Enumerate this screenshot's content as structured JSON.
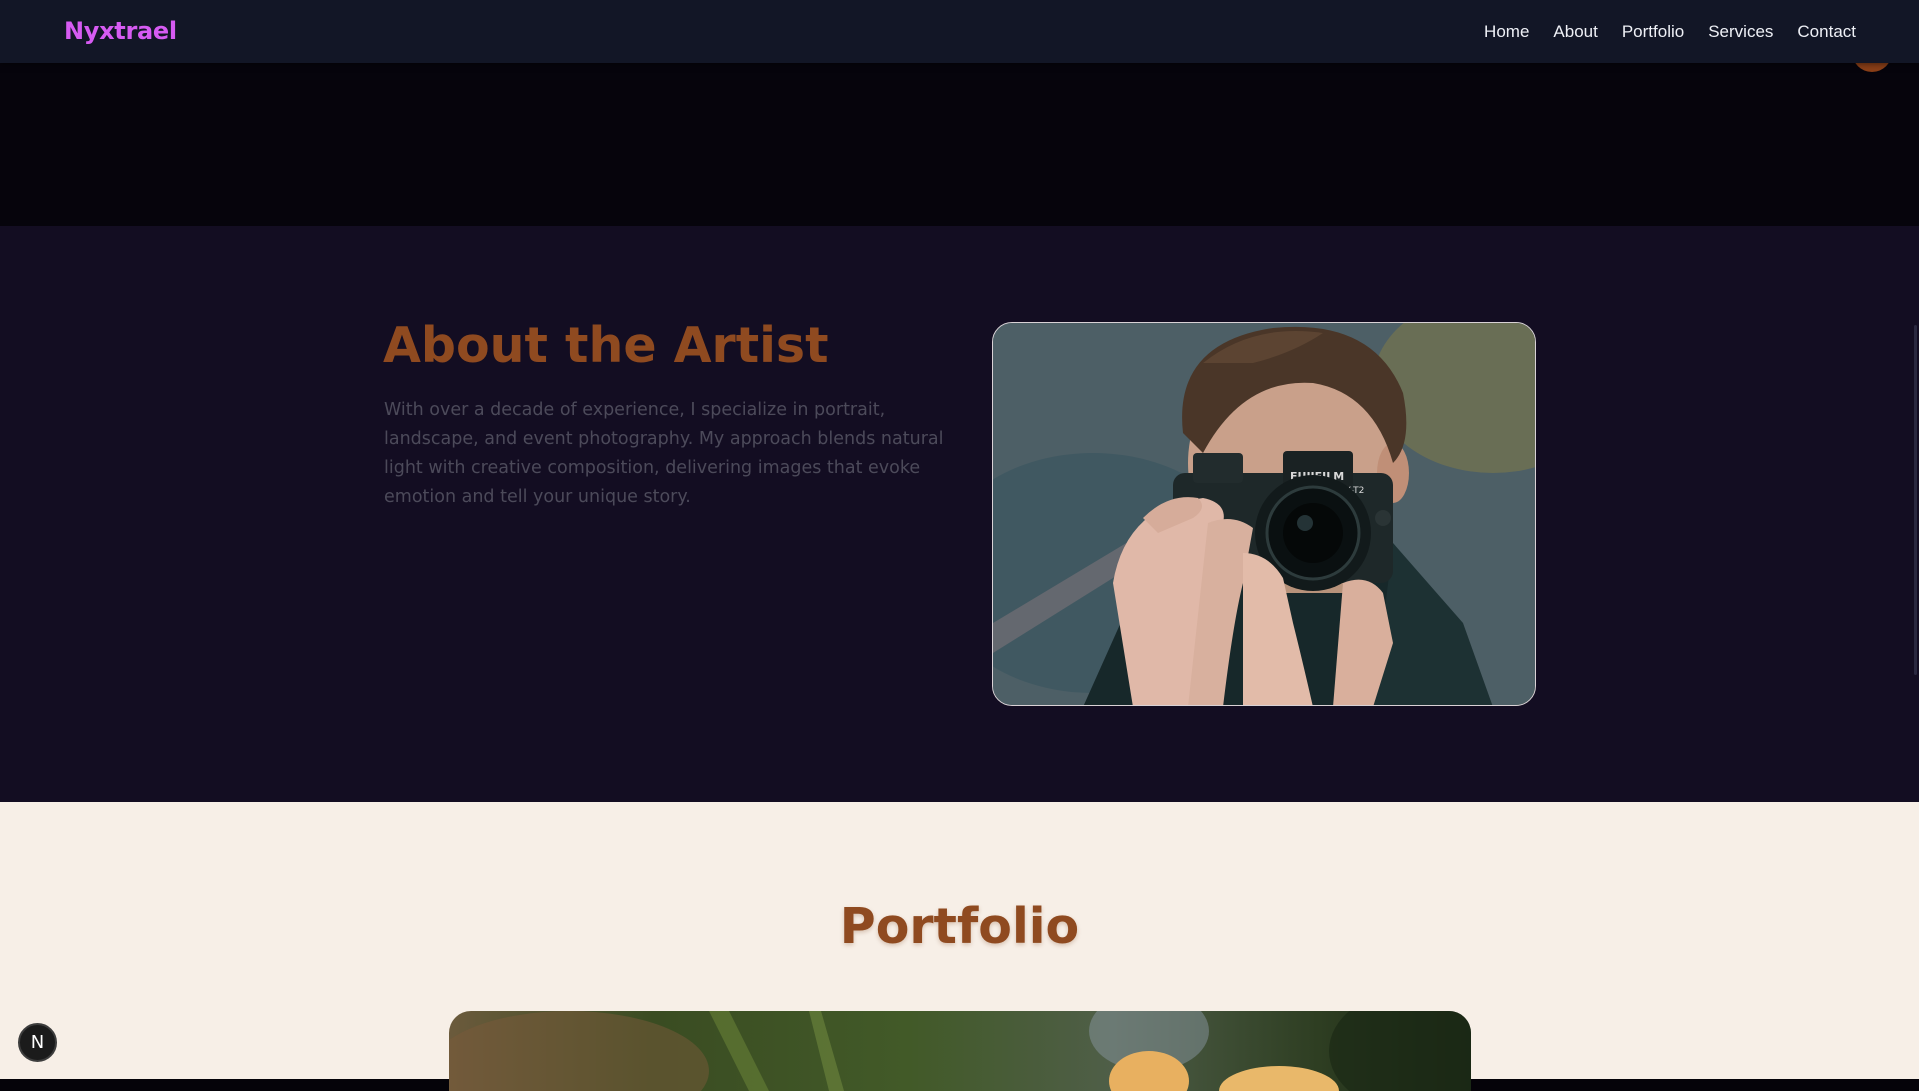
{
  "navbar": {
    "logo": "Nyxtrael",
    "links": [
      "Home",
      "About",
      "Portfolio",
      "Services",
      "Contact"
    ]
  },
  "about": {
    "title": "About the Artist",
    "text": "With over a decade of experience, I specialize in portrait, landscape, and event photography. My approach blends natural light with creative composition, delivering images that evoke emotion and tell your unique story.",
    "camera_brand": "FUJIFILM",
    "camera_model": "X-T2"
  },
  "portfolio": {
    "title": "Portfolio"
  },
  "badge": {
    "label": "N"
  },
  "colors": {
    "navbar_bg": "#121626",
    "logo": "#d65bf2",
    "accent_heading": "#8f4a20",
    "about_bg": "#130d22",
    "portfolio_bg": "#f7efe7"
  },
  "icons": [
    "camera-photo",
    "n-logo-badge"
  ]
}
